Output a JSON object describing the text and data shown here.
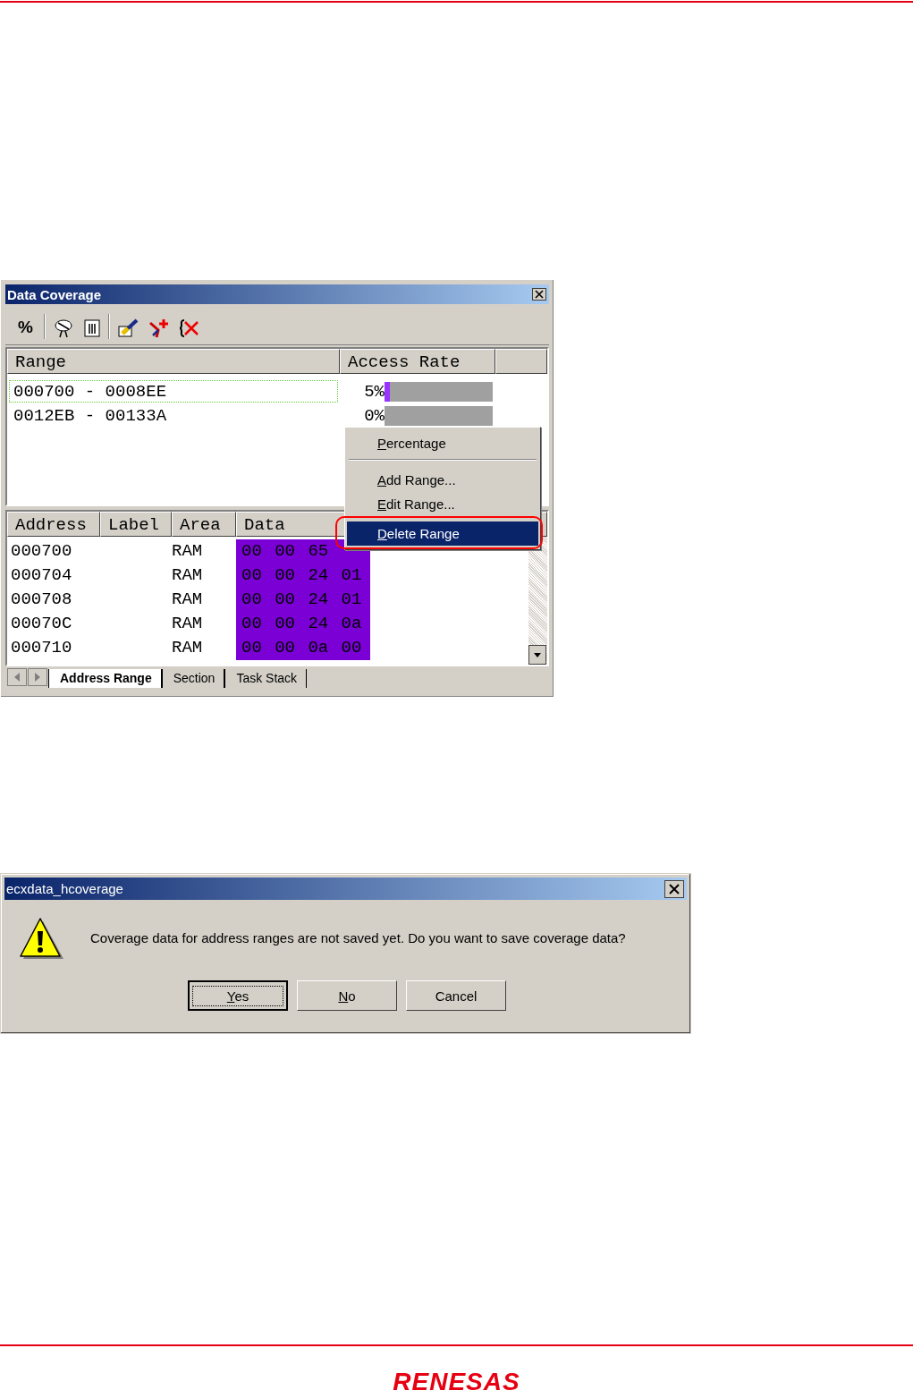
{
  "coverage_window": {
    "title": "Data Coverage",
    "toolbar_percent": "%",
    "range_table": {
      "columns": [
        "Range",
        "Access Rate"
      ],
      "rows": [
        {
          "range": "000700 - 0008EE",
          "rate": "5%",
          "level": 0.05,
          "focused": true
        },
        {
          "range": "0012EB - 00133A",
          "rate": "0%",
          "level": 0,
          "focused": false
        }
      ]
    },
    "data_table": {
      "columns": [
        "Address",
        "Label",
        "Area",
        "Data"
      ],
      "rows": [
        {
          "address": "000700",
          "area": "RAM",
          "data": "00 00 65"
        },
        {
          "address": "000704",
          "area": "RAM",
          "data": "00 00 24 01"
        },
        {
          "address": "000708",
          "area": "RAM",
          "data": "00 00 24 01"
        },
        {
          "address": "00070C",
          "area": "RAM",
          "data": "00 00 24 0a"
        },
        {
          "address": "000710",
          "area": "RAM",
          "data": "00 00 0a 00"
        }
      ]
    },
    "tabs": [
      {
        "label": "Address Range",
        "selected": true
      },
      {
        "label": "Section",
        "selected": false
      },
      {
        "label": "Task Stack",
        "selected": false
      }
    ],
    "context_menu": {
      "items": [
        {
          "kind": "item",
          "label": "Percentage",
          "selected": false
        },
        {
          "kind": "separator"
        },
        {
          "kind": "item",
          "label": "Add Range...",
          "selected": false
        },
        {
          "kind": "item",
          "label": "Edit Range...",
          "selected": false
        },
        {
          "kind": "item",
          "label": "Delete Range",
          "selected": true
        }
      ]
    }
  },
  "dialog": {
    "title": "ecxdata_hcoverage",
    "message": "Coverage data for address ranges are not saved yet. Do you want to save coverage data?",
    "buttons": [
      {
        "label": "Yes",
        "accelerator": true,
        "default": true
      },
      {
        "label": "No",
        "accelerator": true,
        "default": false
      },
      {
        "label": "Cancel",
        "accelerator": false,
        "default": false
      }
    ]
  },
  "footer": {
    "logo": "RENESAS"
  }
}
